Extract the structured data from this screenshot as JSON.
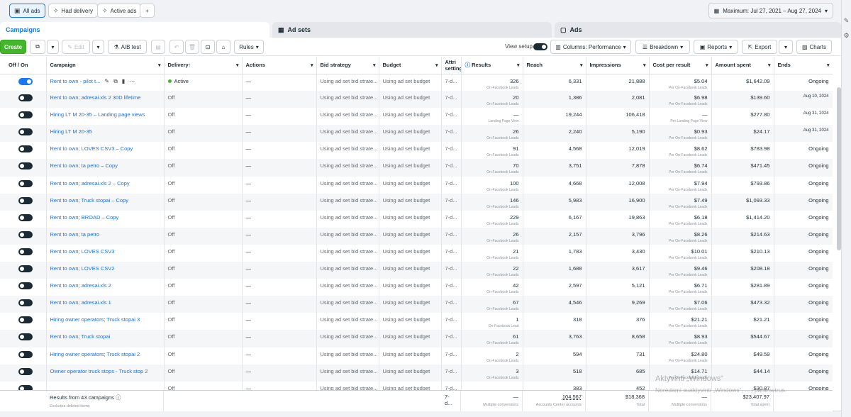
{
  "filters": {
    "all_ads": "All ads",
    "had_delivery": "Had delivery",
    "active_ads": "Active ads",
    "add": "+"
  },
  "date_range": "Maximum: Jul 27, 2021 – Aug 27, 2024",
  "tabs": {
    "campaigns": "Campaigns",
    "ad_sets": "Ad sets",
    "ads": "Ads"
  },
  "toolbar": {
    "create": "Create",
    "edit": "Edit",
    "ab_test": "A/B test",
    "rules": "Rules",
    "view_setup": "View setup",
    "columns": "Columns: Performance",
    "breakdown": "Breakdown",
    "reports": "Reports",
    "export": "Export",
    "charts": "Charts"
  },
  "columns": [
    "Off / On",
    "Campaign",
    "Delivery",
    "Actions",
    "Bid strategy",
    "Budget",
    "Attri setting",
    "Results",
    "Reach",
    "Impressions",
    "Cost per result",
    "Amount spent",
    "Ends"
  ],
  "rows": [
    {
      "on": true,
      "name": "Rent to own - pilot t...",
      "delivery": "Active",
      "actions": "—",
      "bid": "Using ad set bid strate...",
      "budget": "Using ad set budget",
      "attr": "7-d...",
      "results": "326",
      "results_sub": "On-Facebook Leads",
      "reach": "6,331",
      "impressions": "21,888",
      "cpr": "$5.04",
      "cpr_sub": "Per On-Facebook Leads",
      "spent": "$1,642.09",
      "ends": "Ongoing"
    },
    {
      "on": false,
      "name": "Rent to own; adresai.xls 2 30D lifetime",
      "delivery": "Off",
      "actions": "—",
      "bid": "Using ad set bid strate...",
      "budget": "Using ad set budget",
      "attr": "7-d...",
      "results": "20",
      "results_sub": "On-Facebook Leads",
      "reach": "1,386",
      "impressions": "2,081",
      "cpr": "$6.98",
      "cpr_sub": "Per On-Facebook Leads",
      "spent": "$139.60",
      "ends": "Aug 10, 2024"
    },
    {
      "on": false,
      "name": "Hiring LT M 20-35 – Landing page views",
      "delivery": "Off",
      "actions": "—",
      "bid": "Using ad set bid strate...",
      "budget": "Using ad set budget",
      "attr": "7-d...",
      "results": "—",
      "results_sub": "Landing Page View",
      "reach": "19,244",
      "impressions": "106,418",
      "cpr": "—",
      "cpr_sub": "Per Landing Page View",
      "spent": "$277.80",
      "ends": "Aug 31, 2024"
    },
    {
      "on": false,
      "name": "Hiring LT M 20-35",
      "delivery": "Off",
      "actions": "—",
      "bid": "Using ad set bid strate...",
      "budget": "Using ad set budget",
      "attr": "7-d...",
      "results": "26",
      "results_sub": "On-Facebook Leads",
      "reach": "2,240",
      "impressions": "5,190",
      "cpr": "$0.93",
      "cpr_sub": "Per On-Facebook Leads",
      "spent": "$24.17",
      "ends": "Aug 31, 2024"
    },
    {
      "on": false,
      "name": "Rent to own; LOVES CSV3 – Copy",
      "delivery": "Off",
      "actions": "—",
      "bid": "Using ad set bid strate...",
      "budget": "Using ad set budget",
      "attr": "7-d...",
      "results": "91",
      "results_sub": "On-Facebook Leads",
      "reach": "4,568",
      "impressions": "12,019",
      "cpr": "$8.62",
      "cpr_sub": "Per On-Facebook Leads",
      "spent": "$783.98",
      "ends": "Ongoing"
    },
    {
      "on": false,
      "name": "Rent to own; ta petro – Copy",
      "delivery": "Off",
      "actions": "—",
      "bid": "Using ad set bid strate...",
      "budget": "Using ad set budget",
      "attr": "7-d...",
      "results": "70",
      "results_sub": "On-Facebook Leads",
      "reach": "3,751",
      "impressions": "7,878",
      "cpr": "$6.74",
      "cpr_sub": "Per On-Facebook Leads",
      "spent": "$471.45",
      "ends": "Ongoing"
    },
    {
      "on": false,
      "name": "Rent to own; adresai.xls 2 – Copy",
      "delivery": "Off",
      "actions": "—",
      "bid": "Using ad set bid strate...",
      "budget": "Using ad set budget",
      "attr": "7-d...",
      "results": "100",
      "results_sub": "On-Facebook Leads",
      "reach": "4,668",
      "impressions": "12,008",
      "cpr": "$7.94",
      "cpr_sub": "Per On-Facebook Leads",
      "spent": "$793.86",
      "ends": "Ongoing"
    },
    {
      "on": false,
      "name": "Rent to own; Truck stopai – Copy",
      "delivery": "Off",
      "actions": "—",
      "bid": "Using ad set bid strate...",
      "budget": "Using ad set budget",
      "attr": "7-d...",
      "results": "146",
      "results_sub": "On-Facebook Leads",
      "reach": "5,983",
      "impressions": "16,900",
      "cpr": "$7.49",
      "cpr_sub": "Per On-Facebook Leads",
      "spent": "$1,093.33",
      "ends": "Ongoing"
    },
    {
      "on": false,
      "name": "Rent to own; BROAD – Copy",
      "delivery": "Off",
      "actions": "—",
      "bid": "Using ad set bid strate...",
      "budget": "Using ad set budget",
      "attr": "7-d...",
      "results": "229",
      "results_sub": "On-Facebook Leads",
      "reach": "6,167",
      "impressions": "19,863",
      "cpr": "$6.18",
      "cpr_sub": "Per On-Facebook Leads",
      "spent": "$1,414.20",
      "ends": "Ongoing"
    },
    {
      "on": false,
      "name": "Rent to own; ta petro",
      "delivery": "Off",
      "actions": "—",
      "bid": "Using ad set bid strate...",
      "budget": "Using ad set budget",
      "attr": "7-d...",
      "results": "26",
      "results_sub": "On-Facebook Leads",
      "reach": "2,157",
      "impressions": "3,796",
      "cpr": "$8.26",
      "cpr_sub": "Per On-Facebook Leads",
      "spent": "$214.63",
      "ends": "Ongoing"
    },
    {
      "on": false,
      "name": "Rent to own; LOVES CSV3",
      "delivery": "Off",
      "actions": "—",
      "bid": "Using ad set bid strate...",
      "budget": "Using ad set budget",
      "attr": "7-d...",
      "results": "21",
      "results_sub": "On-Facebook Leads",
      "reach": "1,783",
      "impressions": "3,430",
      "cpr": "$10.01",
      "cpr_sub": "Per On-Facebook Leads",
      "spent": "$210.13",
      "ends": "Ongoing"
    },
    {
      "on": false,
      "name": "Rent to own; LOVES CSV2",
      "delivery": "Off",
      "actions": "—",
      "bid": "Using ad set bid strate...",
      "budget": "Using ad set budget",
      "attr": "7-d...",
      "results": "22",
      "results_sub": "On-Facebook Leads",
      "reach": "1,688",
      "impressions": "3,617",
      "cpr": "$9.46",
      "cpr_sub": "Per On-Facebook Leads",
      "spent": "$208.18",
      "ends": "Ongoing"
    },
    {
      "on": false,
      "name": "Rent to own; adresai.xls 2",
      "delivery": "Off",
      "actions": "—",
      "bid": "Using ad set bid strate...",
      "budget": "Using ad set budget",
      "attr": "7-d...",
      "results": "42",
      "results_sub": "On-Facebook Leads",
      "reach": "2,597",
      "impressions": "5,121",
      "cpr": "$6.71",
      "cpr_sub": "Per On-Facebook Leads",
      "spent": "$281.89",
      "ends": "Ongoing"
    },
    {
      "on": false,
      "name": "Rent to own; adresai.xls 1",
      "delivery": "Off",
      "actions": "—",
      "bid": "Using ad set bid strate...",
      "budget": "Using ad set budget",
      "attr": "7-d...",
      "results": "67",
      "results_sub": "On-Facebook Leads",
      "reach": "4,546",
      "impressions": "9,269",
      "cpr": "$7.06",
      "cpr_sub": "Per On-Facebook Leads",
      "spent": "$473.32",
      "ends": "Ongoing"
    },
    {
      "on": false,
      "name": "Hiring owner operators; Truck stopai 3",
      "delivery": "Off",
      "actions": "—",
      "bid": "Using ad set bid strate...",
      "budget": "Using ad set budget",
      "attr": "7-d...",
      "results": "1",
      "results_sub": "On-Facebook Lead",
      "reach": "318",
      "impressions": "376",
      "cpr": "$21.21",
      "cpr_sub": "Per On-Facebook Leads",
      "spent": "$21.21",
      "ends": "Ongoing"
    },
    {
      "on": false,
      "name": "Rent to own; Truck stopai",
      "delivery": "Off",
      "actions": "—",
      "bid": "Using ad set bid strate...",
      "budget": "Using ad set budget",
      "attr": "7-d...",
      "results": "61",
      "results_sub": "On-Facebook Leads",
      "reach": "3,763",
      "impressions": "8,658",
      "cpr": "$8.93",
      "cpr_sub": "Per On-Facebook Leads",
      "spent": "$544.67",
      "ends": "Ongoing"
    },
    {
      "on": false,
      "name": "Hiring owner operators; Truck stopai 2",
      "delivery": "Off",
      "actions": "—",
      "bid": "Using ad set bid strate...",
      "budget": "Using ad set budget",
      "attr": "7-d...",
      "results": "2",
      "results_sub": "On-Facebook Leads",
      "reach": "594",
      "impressions": "731",
      "cpr": "$24.80",
      "cpr_sub": "Per On-Facebook Leads",
      "spent": "$49.59",
      "ends": "Ongoing"
    },
    {
      "on": false,
      "name": "Owner operator truck stops - Truck stop 2",
      "delivery": "Off",
      "actions": "—",
      "bid": "Using ad set bid strate...",
      "budget": "Using ad set budget",
      "attr": "7-d...",
      "results": "3",
      "results_sub": "On-Facebook Leads",
      "reach": "518",
      "impressions": "685",
      "cpr": "$14.71",
      "cpr_sub": "Per On-Facebook Leads",
      "spent": "$44.14",
      "ends": "Ongoing"
    },
    {
      "on": false,
      "name": "",
      "delivery": "Off",
      "actions": "—",
      "bid": "Using ad set bid strate...",
      "budget": "Using ad set budget",
      "attr": "7-d...",
      "results": "",
      "results_sub": "",
      "reach": "383",
      "impressions": "452",
      "cpr": "",
      "cpr_sub": "",
      "spent": "$30.87",
      "ends": "Ongoing"
    }
  ],
  "footer": {
    "results_label": "Results from 43 campaigns",
    "excludes": "Excludes deleted items",
    "attr": "7-d...",
    "results": "—",
    "results_sub": "Multiple conversions",
    "reach": "104,567",
    "reach_sub": "Accounts Center accounts",
    "impressions": "$18,368",
    "impressions_sub": "Total",
    "cpr": "—",
    "cpr_sub": "Multiple conversions",
    "spent": "$23,407.97",
    "spent_sub": "Total spent"
  },
  "watermark": {
    "line1": "Aktyvinti „Windows“",
    "line2": "Norėdami suaktyvinti „Windows“, ... į parametrus."
  },
  "colors": {
    "accent": "#1877f2",
    "create": "#42b72a",
    "link": "#216fdb"
  }
}
